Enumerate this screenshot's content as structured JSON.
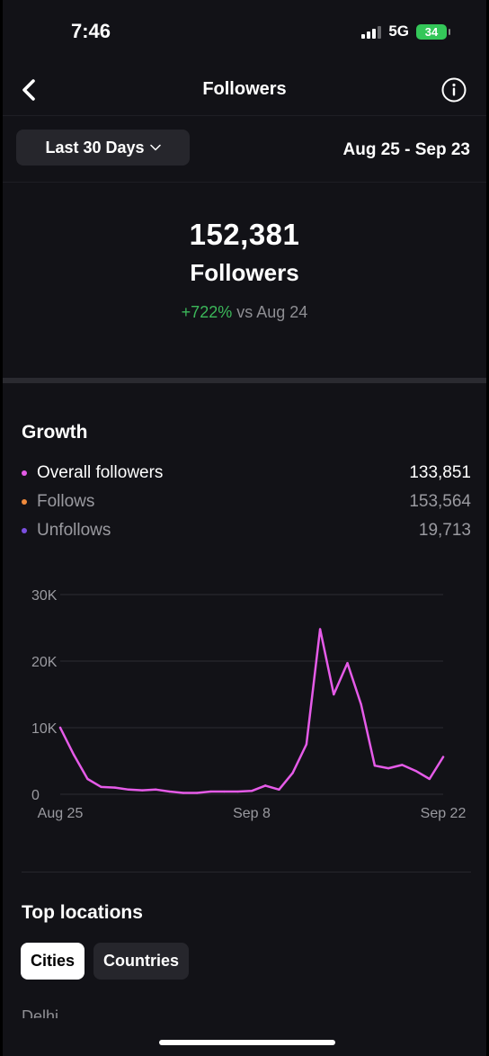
{
  "status_bar": {
    "time": "7:46",
    "network": "5G",
    "battery": "34"
  },
  "nav": {
    "title": "Followers"
  },
  "range": {
    "label": "Last 30 Days",
    "dates": "Aug 25 - Sep 23"
  },
  "summary": {
    "count": "152,381",
    "label": "Followers",
    "change_pct": "+722%",
    "change_text": "vs Aug 24"
  },
  "growth": {
    "title": "Growth",
    "metrics": [
      {
        "label": "Overall followers",
        "value": "133,851",
        "color": "#e55be8",
        "label_color": "#ffffff",
        "value_color": "#ffffff"
      },
      {
        "label": "Follows",
        "value": "153,564",
        "color": "#f08a3c",
        "label_color": "#9a9aa0",
        "value_color": "#9a9aa0"
      },
      {
        "label": "Unfollows",
        "value": "19,713",
        "color": "#7b4fe0",
        "label_color": "#9a9aa0",
        "value_color": "#9a9aa0"
      }
    ]
  },
  "chart_data": {
    "type": "line",
    "title": "",
    "xlabel": "",
    "ylabel": "",
    "ylim": [
      0,
      30000
    ],
    "y_ticks": [
      {
        "value": 30000,
        "label": "30K"
      },
      {
        "value": 20000,
        "label": "20K"
      },
      {
        "value": 10000,
        "label": "10K"
      },
      {
        "value": 0,
        "label": "0"
      }
    ],
    "x_tick_labels": [
      "Aug 25",
      "Sep 8",
      "Sep 22"
    ],
    "x_tick_index": [
      0,
      14,
      28
    ],
    "grid": true,
    "series": [
      {
        "color": "#e55be8",
        "values": [
          10000,
          5900,
          2300,
          1100,
          1000,
          700,
          600,
          700,
          400,
          200,
          200,
          400,
          400,
          400,
          500,
          1300,
          700,
          3200,
          7500,
          24800,
          15000,
          19700,
          13500,
          4300,
          3900,
          4400,
          3500,
          2300,
          5600
        ]
      }
    ]
  },
  "locations": {
    "title": "Top locations",
    "tabs": [
      "Cities",
      "Countries"
    ],
    "first_city": "Delhi"
  }
}
